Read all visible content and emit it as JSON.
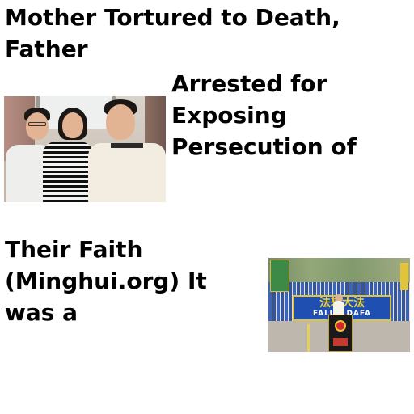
{
  "article": {
    "lines": [
      "Mother Tortured to Death,",
      "Father",
      "Arrested for",
      "Exposing",
      "Persecution of",
      "Their Faith",
      "(Minghui.org) It",
      "was a"
    ]
  },
  "photos": {
    "rally": {
      "banner_text": "法轮大法",
      "banner_subtext": "FALUN DAFA"
    }
  },
  "colors": {
    "text": "#000000",
    "background": "#ffffff",
    "banner_blue": "#1f4fb0",
    "banner_gold": "#f1d23b"
  }
}
